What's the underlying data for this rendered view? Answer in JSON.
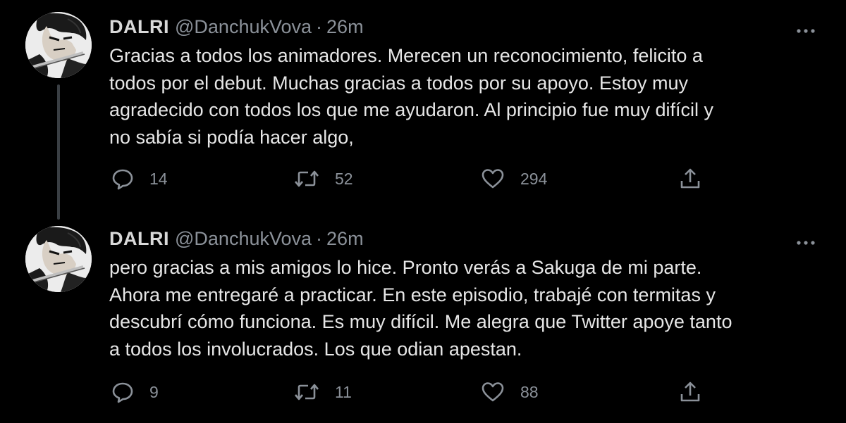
{
  "tweets": [
    {
      "display_name": "DALRI",
      "handle": "@DanchukVova",
      "separator": "·",
      "time": "26m",
      "text": "Gracias a todos los animadores. Merecen un reconocimiento, felicito a\ntodos por el debut. Muchas gracias a todos por su apoyo. Estoy muy\nagradecido con todos los que me ayudaron. Al principio fue muy difícil y\nno sabía si podía hacer algo,",
      "replies": "14",
      "retweets": "52",
      "likes": "294"
    },
    {
      "display_name": "DALRI",
      "handle": "@DanchukVova",
      "separator": "·",
      "time": "26m",
      "text": "pero gracias a mis amigos lo hice. Pronto verás a Sakuga de mi parte.\nAhora me entregaré a practicar. En este episodio, trabajé con termitas y\ndescubrí cómo funciona. Es muy difícil. Me alegra que Twitter apoye tanto\na todos los involucrados. Los que odian apestan.",
      "replies": "9",
      "retweets": "11",
      "likes": "88"
    }
  ],
  "icons": {
    "reply": "speech-bubble-icon",
    "retweet": "retweet-arrows-icon",
    "like": "heart-icon",
    "share": "share-upload-icon",
    "more": "more-dots-icon"
  },
  "colors": {
    "background": "#000000",
    "text": "#d9d9d9",
    "secondary_text": "#8b9199",
    "thread_line": "#3a3f44"
  }
}
